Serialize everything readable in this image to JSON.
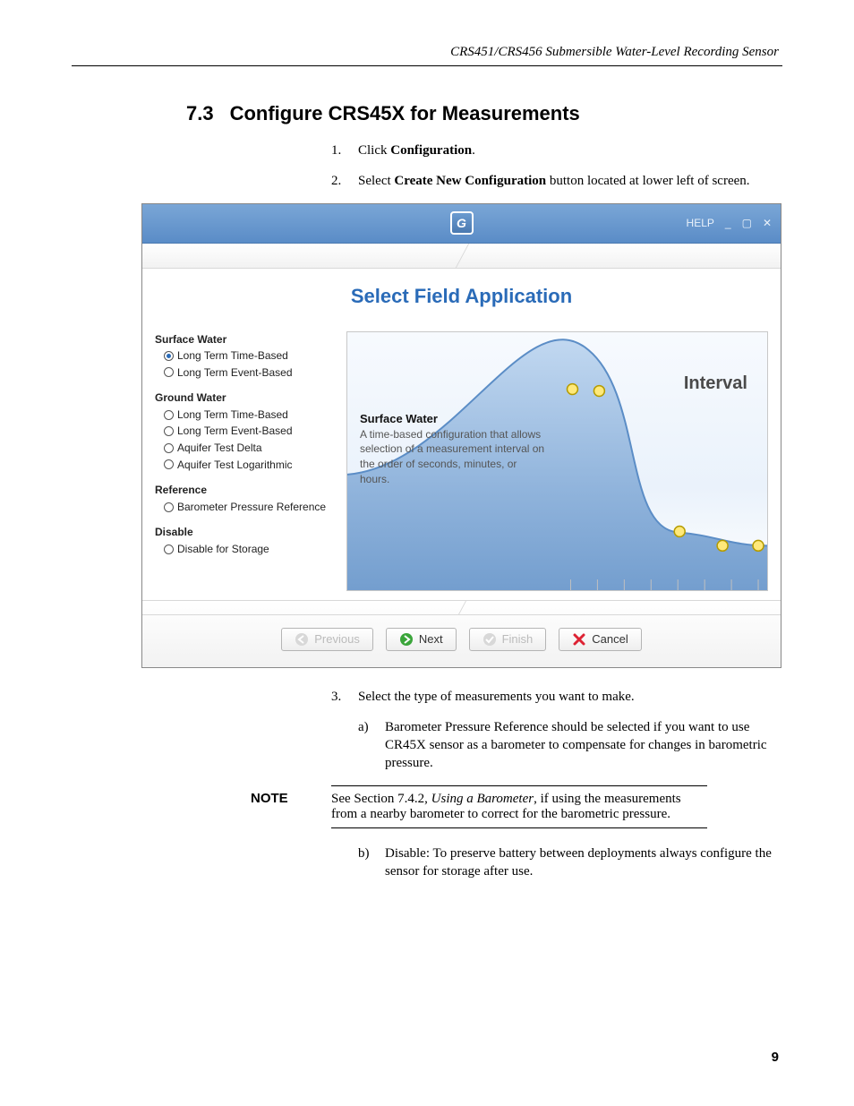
{
  "header": {
    "running_title": "CRS451/CRS456 Submersible Water-Level Recording Sensor"
  },
  "section": {
    "number": "7.3",
    "title": "Configure CRS45X for Measurements"
  },
  "steps": {
    "s1": {
      "marker": "1.",
      "pre": "Click ",
      "bold": "Configuration",
      "post": "."
    },
    "s2": {
      "marker": "2.",
      "pre": "Select ",
      "bold": "Create New Configuration",
      "post": " button located at lower left of screen."
    },
    "s3": {
      "marker": "3.",
      "text": "Select the type of measurements you want to make."
    },
    "s3a": {
      "marker": "a)",
      "text": "Barometer Pressure Reference should be selected if you want to use CR45X sensor as a barometer to compensate for changes in barometric pressure."
    },
    "s3b": {
      "marker": "b)",
      "text": "Disable: To preserve battery between deployments always configure the sensor for storage after use."
    }
  },
  "note": {
    "label": "NOTE",
    "pre": "See Section 7.4.2, ",
    "italic": "Using a Barometer",
    "post": ", if using the measurements from a nearby barometer to correct for the barometric pressure."
  },
  "app": {
    "titlebar": {
      "help": "HELP"
    },
    "heading": "Select Field Application",
    "groups": {
      "surface": {
        "head": "Surface Water",
        "opt1": "Long Term Time-Based",
        "opt2": "Long Term Event-Based"
      },
      "ground": {
        "head": "Ground Water",
        "opt1": "Long Term Time-Based",
        "opt2": "Long Term Event-Based",
        "opt3": "Aquifer Test Delta",
        "opt4": "Aquifer Test Logarithmic"
      },
      "reference": {
        "head": "Reference",
        "opt1": "Barometer Pressure Reference"
      },
      "disable": {
        "head": "Disable",
        "opt1": "Disable for Storage"
      }
    },
    "main": {
      "interval": "Interval",
      "desc_head": "Surface Water",
      "desc_body": "A time-based configuration that allows selection of a measurement interval on the order of seconds, minutes, or hours."
    },
    "buttons": {
      "previous": "Previous",
      "next": "Next",
      "finish": "Finish",
      "cancel": "Cancel"
    }
  },
  "page_number": "9"
}
